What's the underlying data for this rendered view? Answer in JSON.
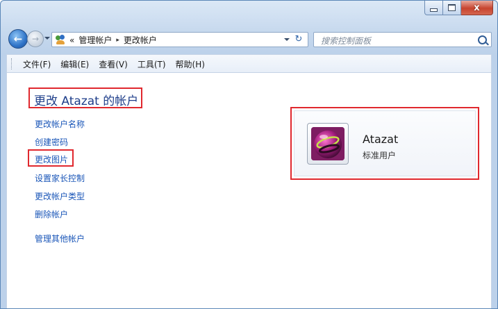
{
  "window": {
    "caption_buttons": [
      {
        "name": "minimize",
        "glyph": "minimize-icon"
      },
      {
        "name": "maximize",
        "glyph": "maximize-icon"
      },
      {
        "name": "close",
        "glyph": "close-icon",
        "label": "x"
      }
    ]
  },
  "nav": {
    "back_glyph": "←",
    "forward_glyph": "→",
    "breadcrumb": {
      "overflow": "«",
      "items": [
        "管理帐户",
        "更改帐户"
      ],
      "separator": "▸"
    },
    "refresh_glyph": "↻"
  },
  "search": {
    "placeholder": "搜索控制面板"
  },
  "menu": {
    "items": [
      "文件(F)",
      "编辑(E)",
      "查看(V)",
      "工具(T)",
      "帮助(H)"
    ]
  },
  "main": {
    "title": "更改 Atazat 的帐户",
    "tasks": [
      "更改帐户名称",
      "创建密码",
      "更改图片",
      "设置家长控制",
      "更改帐户类型",
      "删除帐户"
    ],
    "other_task": "管理其他帐户"
  },
  "account": {
    "name": "Atazat",
    "type": "标准用户",
    "avatar_icon": "user-picture-icon"
  },
  "colors": {
    "highlight": "#e0282e",
    "link": "#1a56b8",
    "heading": "#1e3e8a"
  }
}
